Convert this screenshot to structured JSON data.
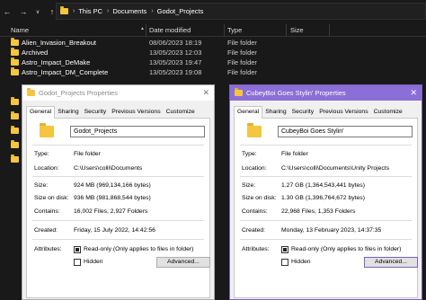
{
  "explorer": {
    "breadcrumbs": [
      "This PC",
      "Documents",
      "Godot_Projects"
    ],
    "columns": {
      "name": "Name",
      "date": "Date modified",
      "type": "Type",
      "size": "Size"
    },
    "rows": [
      {
        "name": "Alien_Invasion_Breakout",
        "date": "08/06/2023 18:19",
        "type": "File folder"
      },
      {
        "name": "Archived",
        "date": "13/05/2023 12:03",
        "type": "File folder"
      },
      {
        "name": "Astro_Impact_DeMake",
        "date": "13/05/2023 19:47",
        "type": "File folder"
      },
      {
        "name": "Astro_Impact_DM_Complete",
        "date": "13/05/2023 19:08",
        "type": "File folder"
      }
    ]
  },
  "dialog1": {
    "title": "Godot_Projects Properties",
    "tabs": [
      "General",
      "Sharing",
      "Security",
      "Previous Versions",
      "Customize"
    ],
    "name_value": "Godot_Projects",
    "type_label": "Type:",
    "type_value": "File folder",
    "location_label": "Location:",
    "location_value": "C:\\Users\\colli\\Documents",
    "size_label": "Size:",
    "size_value": "924 MB (969,134,166 bytes)",
    "size_on_disk_label": "Size on disk:",
    "size_on_disk_value": "936 MB (981,868,544 bytes)",
    "contains_label": "Contains:",
    "contains_value": "16,002 Files, 2,927 Folders",
    "created_label": "Created:",
    "created_value": "Friday, 15 July 2022, 14:42:56",
    "attributes_label": "Attributes:",
    "readonly_label": "Read-only (Only applies to files in folder)",
    "hidden_label": "Hidden",
    "advanced_label": "Advanced..."
  },
  "dialog2": {
    "title": "CubeyBoi Goes Stylin' Properties",
    "tabs": [
      "General",
      "Sharing",
      "Security",
      "Previous Versions",
      "Customize"
    ],
    "name_value": "CubeyBoi Goes Stylin'",
    "type_label": "Type:",
    "type_value": "File folder",
    "location_label": "Location:",
    "location_value": "C:\\Users\\colli\\Documents\\Unity Projects",
    "size_label": "Size:",
    "size_value": "1.27 GB (1,364,543,441 bytes)",
    "size_on_disk_label": "Size on disk:",
    "size_on_disk_value": "1.30 GB (1,396,764,672 bytes)",
    "contains_label": "Contains:",
    "contains_value": "22,968 Files, 1,353 Folders",
    "created_label": "Created:",
    "created_value": "Monday, 13 February 2023, 14:37:35",
    "attributes_label": "Attributes:",
    "readonly_label": "Read-only (Only applies to files in folder)",
    "hidden_label": "Hidden",
    "advanced_label": "Advanced..."
  },
  "icons": {
    "back": "back-arrow-icon",
    "forward": "forward-arrow-icon",
    "recent": "chevron-down-icon",
    "up": "up-arrow-icon",
    "folder": "folder-icon",
    "close": "close-icon"
  },
  "colors": {
    "explorer_bg": "#191919",
    "dialog2_accent": "#8c6fd6",
    "folder": "#f5c540"
  }
}
